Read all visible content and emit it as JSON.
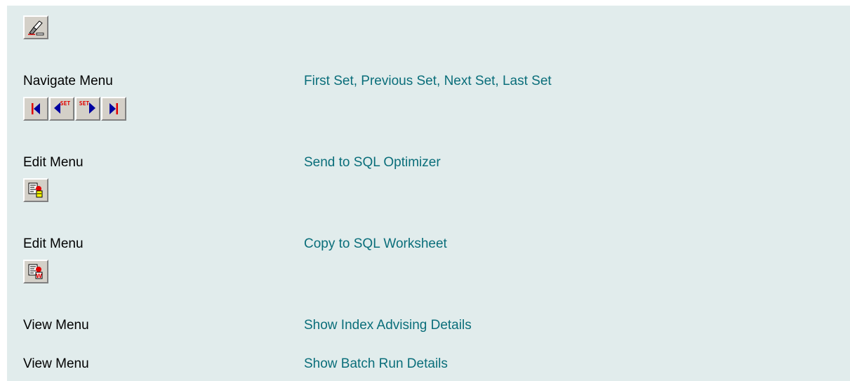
{
  "top_icon": "eraser-icon",
  "rows": [
    {
      "label": "Navigate Menu",
      "action": "First Set, Previous Set, Next Set, Last Set",
      "icons": [
        "first-set-icon",
        "previous-set-icon",
        "next-set-icon",
        "last-set-icon"
      ],
      "icon_text": "SET"
    },
    {
      "label": "Edit Menu",
      "action": "Send to SQL Optimizer",
      "icons": [
        "send-to-sql-optimizer-icon"
      ]
    },
    {
      "label": "Edit Menu",
      "action": "Copy to SQL Worksheet",
      "icons": [
        "copy-to-sql-worksheet-icon"
      ],
      "icon_text": "W"
    },
    {
      "label": "View Menu",
      "action": "Show Index Advising Details"
    },
    {
      "label": "View Menu",
      "action": "Show Batch Run Details"
    }
  ],
  "colors": {
    "panel_bg": "#e1ecec",
    "link": "#0a6e7a",
    "icon_red": "#e00000",
    "icon_blue": "#0000a0"
  }
}
